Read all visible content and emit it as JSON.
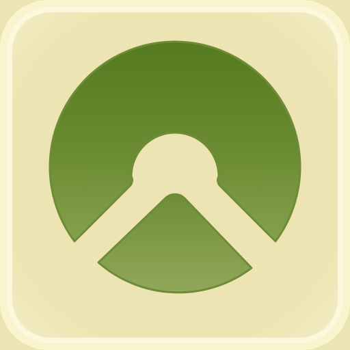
{
  "app_icon": {
    "icon_name": "green-ring-and-wedge-logo",
    "colors": {
      "background_outer": "#f6f2c8",
      "background_inner": "#ece5b3",
      "rim_highlight": "#fbf8de",
      "logo_dark": "#557a1f",
      "logo_light": "#86a14c",
      "logo_outline": "#6f8b37"
    }
  }
}
